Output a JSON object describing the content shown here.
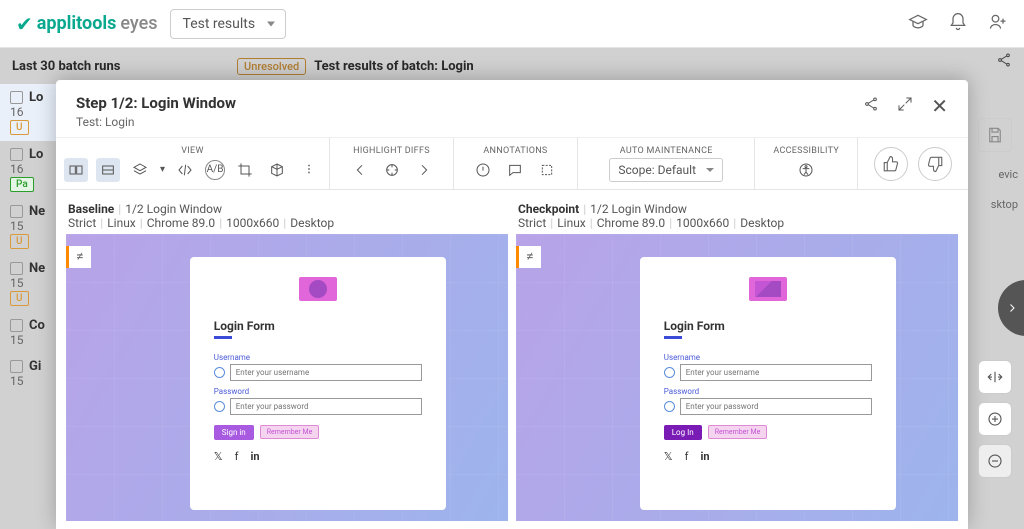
{
  "brand": {
    "bold": "applitools",
    "light": "eyes"
  },
  "nav_dropdown": "Test results",
  "bg": {
    "header_left": "Last 30 batch runs",
    "badge": "Unresolved",
    "header_right": "Test results of batch:  Login",
    "items": [
      {
        "title": "Lo",
        "time": "16",
        "tag": "U",
        "tag_class": "tag-un"
      },
      {
        "title": "Lo",
        "time": "16",
        "tag": "Pa",
        "tag_class": "tag-pa"
      },
      {
        "title": "Ne",
        "time": "15",
        "tag": "U",
        "tag_class": "tag-un"
      },
      {
        "title": "Ne",
        "time": "15",
        "tag": "U",
        "tag_class": "tag-un"
      },
      {
        "title": "Co",
        "time": "15",
        "tag": "",
        "tag_class": ""
      },
      {
        "title": "Gi",
        "time": "15",
        "tag": "",
        "tag_class": ""
      }
    ],
    "right_text1": "evic",
    "right_text2": "sktop"
  },
  "modal": {
    "title": "Step 1/2:  Login Window",
    "subtitle": "Test: Login",
    "sections": {
      "view": "VIEW",
      "highlight": "HIGHLIGHT DIFFS",
      "annotations": "ANNOTATIONS",
      "auto": "AUTO MAINTENANCE",
      "access": "ACCESSIBILITY"
    },
    "scope": "Scope: Default"
  },
  "panes": {
    "left": {
      "name": "Baseline",
      "step": "1/2 Login Window",
      "mode": "Strict",
      "os": "Linux",
      "browser": "Chrome 89.0",
      "viewport": "1000x660",
      "device": "Desktop"
    },
    "right": {
      "name": "Checkpoint",
      "step": "1/2 Login Window",
      "mode": "Strict",
      "os": "Linux",
      "browser": "Chrome 89.0",
      "viewport": "1000x660",
      "device": "Desktop"
    }
  },
  "login": {
    "title": "Login Form",
    "username_label": "Username",
    "username_ph": "Enter your username",
    "password_label": "Password",
    "password_ph": "Enter your password",
    "signin": "Sign in",
    "login": "Log In",
    "remember": "Remember Me"
  },
  "diff_symbol": "≠"
}
